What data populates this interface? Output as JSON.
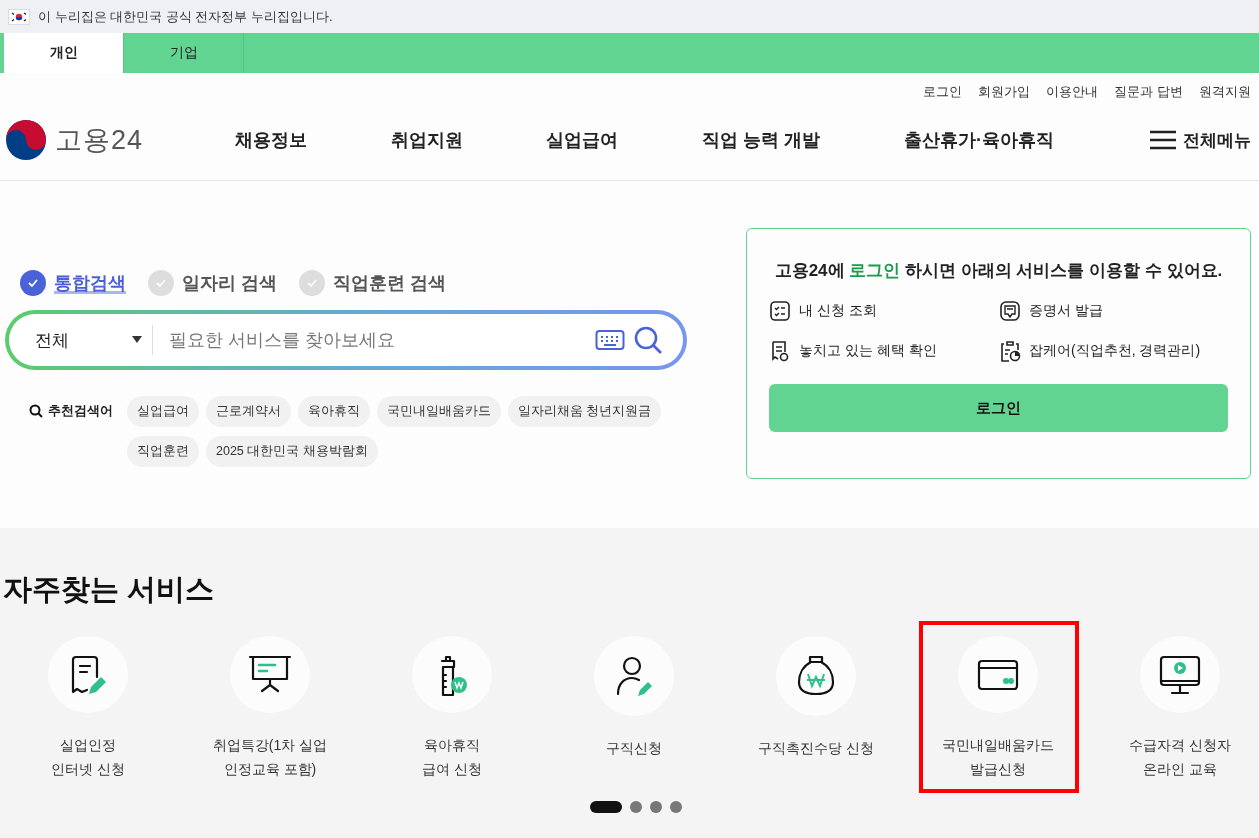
{
  "gov_banner": {
    "text": "이 누리집은 대한민국 공식 전자정부 누리집입니다."
  },
  "audience_tabs": [
    {
      "label": "개인",
      "selected": true
    },
    {
      "label": "기업",
      "selected": false
    }
  ],
  "utility_links": [
    "로그인",
    "회원가입",
    "이용안내",
    "질문과 답변",
    "원격지원"
  ],
  "header": {
    "logo_text": "고용24",
    "nav": [
      "채용정보",
      "취업지원",
      "실업급여",
      "직업 능력 개발",
      "출산휴가·육아휴직"
    ],
    "menu_label": "전체메뉴"
  },
  "search": {
    "types": [
      {
        "label": "통합검색",
        "selected": true
      },
      {
        "label": "일자리 검색",
        "selected": false
      },
      {
        "label": "직업훈련 검색",
        "selected": false
      }
    ],
    "category": "전체",
    "placeholder": "필요한 서비스를 찾아보세요",
    "recommended_label": "추천검색어",
    "keywords": [
      "실업급여",
      "근로계약서",
      "육아휴직",
      "국민내일배움카드",
      "일자리채움 청년지원금",
      "직업훈련",
      "2025 대한민국 채용박람회"
    ]
  },
  "login_card": {
    "title_prefix": "고용24에 ",
    "title_highlight": "로그인",
    "title_suffix": " 하시면 아래의 서비스를 이용할 수 있어요.",
    "services": [
      {
        "kind": "checklist",
        "label": "내 신청 조회"
      },
      {
        "kind": "certificate",
        "label": "증명서 발급"
      },
      {
        "kind": "document-search",
        "label": "놓치고 있는 혜택 확인"
      },
      {
        "kind": "clipboard-chart",
        "label": "잡케어(직업추천, 경력관리)"
      }
    ],
    "button": "로그인"
  },
  "frequent_services": {
    "title": "자주찾는 서비스",
    "items": [
      {
        "kind": "document-pen",
        "label": "실업인정\n인터넷 신청",
        "highlighted": false
      },
      {
        "kind": "easel",
        "label": "취업특강(1차 실업\n인정교육 포함)",
        "highlighted": false
      },
      {
        "kind": "bottle",
        "label": "육아휴직\n급여 신청",
        "highlighted": false
      },
      {
        "kind": "person-pen",
        "label": "구직신청",
        "highlighted": false
      },
      {
        "kind": "money-bag",
        "label": "구직촉진수당 신청",
        "highlighted": false
      },
      {
        "kind": "card",
        "label": "국민내일배움카드\n발급신청",
        "highlighted": true
      },
      {
        "kind": "monitor",
        "label": "수급자격 신청자\n온라인 교육",
        "highlighted": false
      }
    ],
    "pagination": [
      {
        "selected": true
      },
      {
        "selected": false
      },
      {
        "selected": false
      },
      {
        "selected": false
      }
    ]
  }
}
